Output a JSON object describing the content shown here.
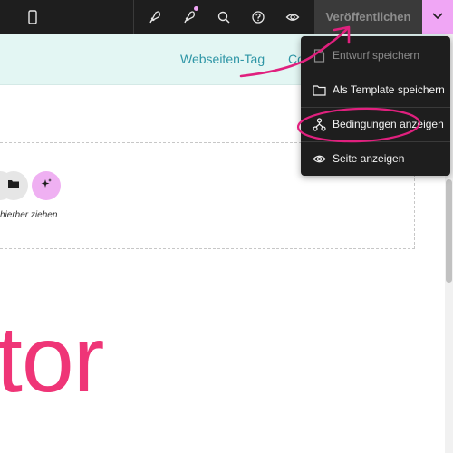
{
  "toolbar": {
    "device_icon": "mobile-device-icon",
    "icons": [
      "rocket-icon",
      "rocket-notification-icon",
      "search-icon",
      "help-icon",
      "eye-icon"
    ],
    "publish_label": "Veröffentlichen",
    "dropdown_icon": "chevron-down-icon",
    "accent": "#f0a6f5"
  },
  "nav": {
    "links": [
      "Webseiten-Tag",
      "Co"
    ]
  },
  "editor": {
    "drop_hint": "hierher ziehen",
    "big_text": "tor",
    "big_text_color": "#ef3577"
  },
  "menu": {
    "items": [
      {
        "label": "Entwurf speichern",
        "icon": "file-icon",
        "enabled": false
      },
      {
        "label": "Als Template speichern",
        "icon": "folder-icon",
        "enabled": true
      },
      {
        "label": "Bedingungen anzeigen",
        "icon": "conditions-icon",
        "enabled": true
      },
      {
        "label": "Seite anzeigen",
        "icon": "eye-icon",
        "enabled": true
      }
    ]
  },
  "annotation_color": "#e0207e"
}
